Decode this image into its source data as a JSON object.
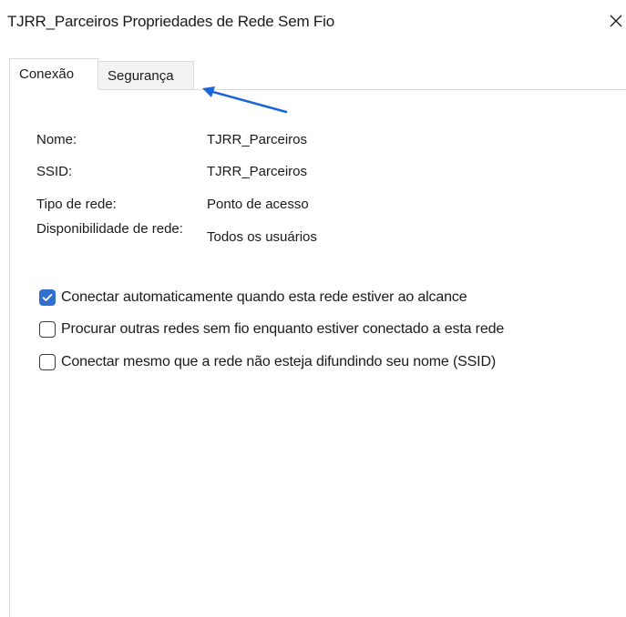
{
  "window": {
    "title": "TJRR_Parceiros Propriedades de Rede Sem Fio",
    "close_icon": "close-icon"
  },
  "tabs": [
    {
      "label": "Conexão",
      "active": true
    },
    {
      "label": "Segurança",
      "active": false
    }
  ],
  "annotation": {
    "arrow_color": "#1a66d6",
    "icon": "arrow-pointer-icon"
  },
  "properties": [
    {
      "label": "Nome:",
      "value": "TJRR_Parceiros"
    },
    {
      "label": "SSID:",
      "value": "TJRR_Parceiros"
    },
    {
      "label": "Tipo de rede:",
      "value": "Ponto de acesso"
    },
    {
      "label": "Disponibilidade de rede:",
      "value": "Todos os usuários"
    }
  ],
  "options": [
    {
      "label": "Conectar automaticamente quando esta rede estiver ao alcance",
      "checked": true
    },
    {
      "label": "Procurar outras redes sem fio enquanto estiver conectado a esta rede",
      "checked": false
    },
    {
      "label": "Conectar mesmo que a rede não esteja difundindo seu nome (SSID)",
      "checked": false
    }
  ],
  "colors": {
    "accent": "#2f6fce",
    "border": "#d9d9d9"
  }
}
